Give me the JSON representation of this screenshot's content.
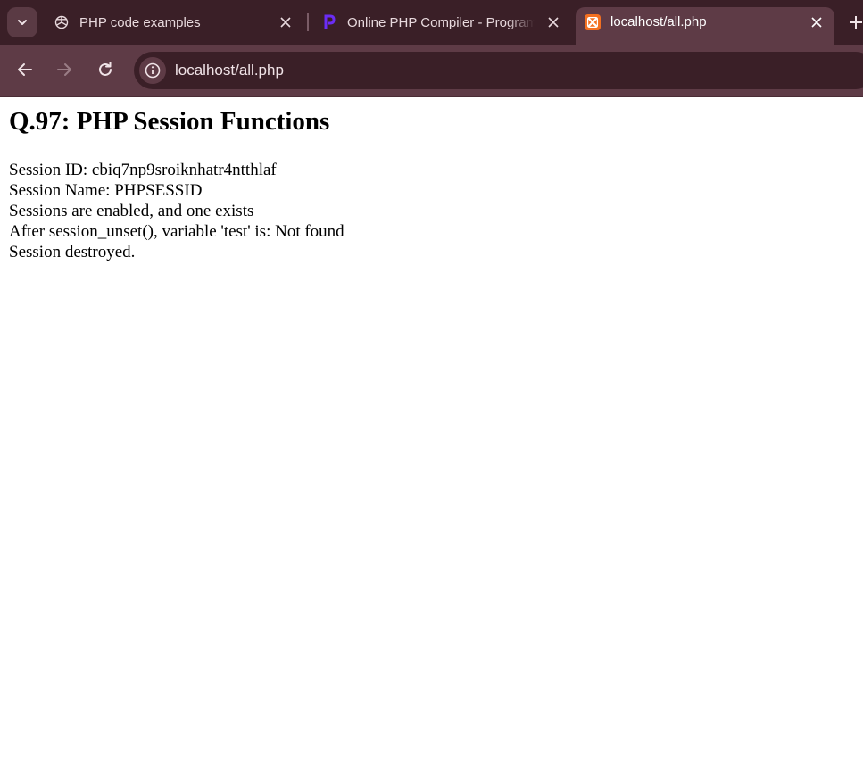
{
  "browser": {
    "tabs": [
      {
        "title": "PHP code examples",
        "icon": "openai-icon",
        "active": false
      },
      {
        "title": "Online PHP Compiler - Programiz",
        "icon": "programiz-icon",
        "active": false
      },
      {
        "title": "localhost/all.php",
        "icon": "xampp-icon",
        "active": true
      }
    ],
    "address": "localhost/all.php"
  },
  "page": {
    "heading": "Q.97: PHP Session Functions",
    "lines": [
      "Session ID: cbiq7np9sroiknhatr4ntthlaf",
      "Session Name: PHPSESSID",
      "Sessions are enabled, and one exists",
      "After session_unset(), variable 'test' is: Not found",
      "Session destroyed."
    ]
  },
  "colors": {
    "tabstrip": "#3a1f27",
    "toolbar": "#5e3b46",
    "xampp_orange": "#f37021",
    "programiz_purple": "#6b2cf5"
  }
}
